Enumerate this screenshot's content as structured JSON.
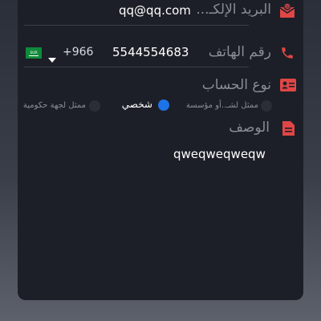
{
  "email": {
    "label": "البريد الإلكـ...",
    "value": "qq@qq.com"
  },
  "phone": {
    "label": "رقم الهاتف",
    "number": "5544554683",
    "country_code": "+966",
    "flag_text": "SUR"
  },
  "account_type": {
    "label": "نوع الحساب",
    "options": [
      {
        "label": "ممثل لشـ..أو مؤسسة",
        "selected": false
      },
      {
        "label": "شخصي",
        "selected": true
      },
      {
        "label": "ممثل لجهة حكومية",
        "selected": false
      }
    ]
  },
  "description": {
    "label": "الوصف",
    "value": "qweqweqweqw"
  },
  "colors": {
    "accent_red": "#e04646",
    "radio_selected": "#1e73e8",
    "card_bg": "#1c1f27"
  },
  "icons": {
    "email": "email-envelope-icon",
    "phone": "phone-icon",
    "account": "id-card-icon",
    "description": "document-icon",
    "dropdown": "caret-down-icon",
    "flag": "saudi-flag-icon"
  }
}
